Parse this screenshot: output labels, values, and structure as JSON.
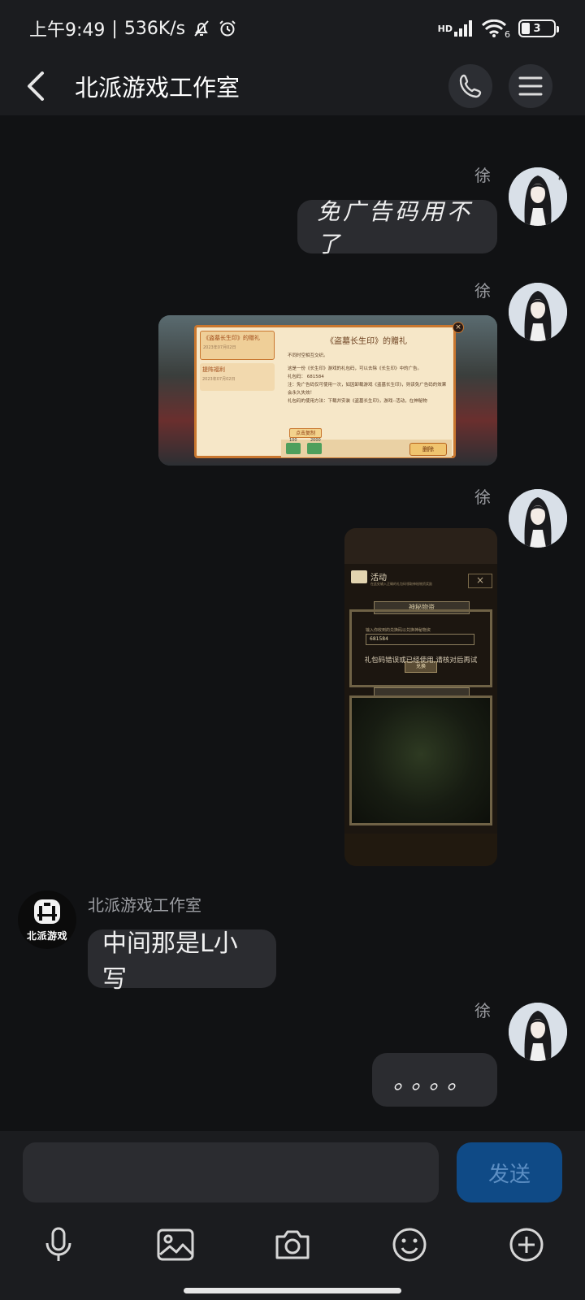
{
  "status_bar": {
    "time": "上午9:49",
    "net_speed": "536K/s",
    "signal_tech": "HD",
    "wifi_index": "6",
    "battery_level": "3"
  },
  "header": {
    "title": "北派游戏工作室"
  },
  "messages": [
    {
      "sender": "徐",
      "type": "text",
      "text": "免广告码用不了"
    },
    {
      "sender": "徐",
      "type": "image"
    },
    {
      "sender": "徐",
      "type": "image"
    },
    {
      "sender": "北派游戏工作室",
      "type": "text",
      "text": "中间那是L小写"
    },
    {
      "sender": "徐",
      "type": "text",
      "text": "。。。。"
    }
  ],
  "screenshot1": {
    "tab1": "《盗墓长生印》的赠礼",
    "tab1_sub": "2023年07月02日",
    "tab2": "提阵福利",
    "tab2_sub": "2023年07月02日",
    "dialog_title": "《盗墓长生印》的赠礼",
    "line1": "不同时空相互交织。",
    "line2": "这是一份《长生印》游戏的礼包码，可以去除《长生印》中的广告。",
    "line3": "礼包码：  681584",
    "line4": "注：免广告码仅可使用一次，如因卸载游戏《盗墓长生印》，则该免广告码的效果会永久失效！",
    "line5": "礼包码的使用方法：下载并安装《盗墓长生印》，游戏--活动，在神秘物",
    "copy_button": "点击复制",
    "reward1": "100",
    "reward2": "2000",
    "delete_button": "删除"
  },
  "screenshot2": {
    "panel_title": "活动",
    "panel_subtitle": "在此处输入正确的礼包码领取神秘物资奖励",
    "section_title": "神秘物资",
    "input_hint": "输入你收到的兑换码以兑换神秘物资",
    "code_value": "681584",
    "error_text": "礼包码错误或已经使用,请核对后再试",
    "redeem_button": "兑换"
  },
  "input": {
    "placeholder": "",
    "send_label": "发送"
  },
  "colors": {
    "background": "#111214",
    "bar": "#1b1c1f",
    "bubble": "#2b2c30",
    "send_button": "#0f4a86"
  }
}
